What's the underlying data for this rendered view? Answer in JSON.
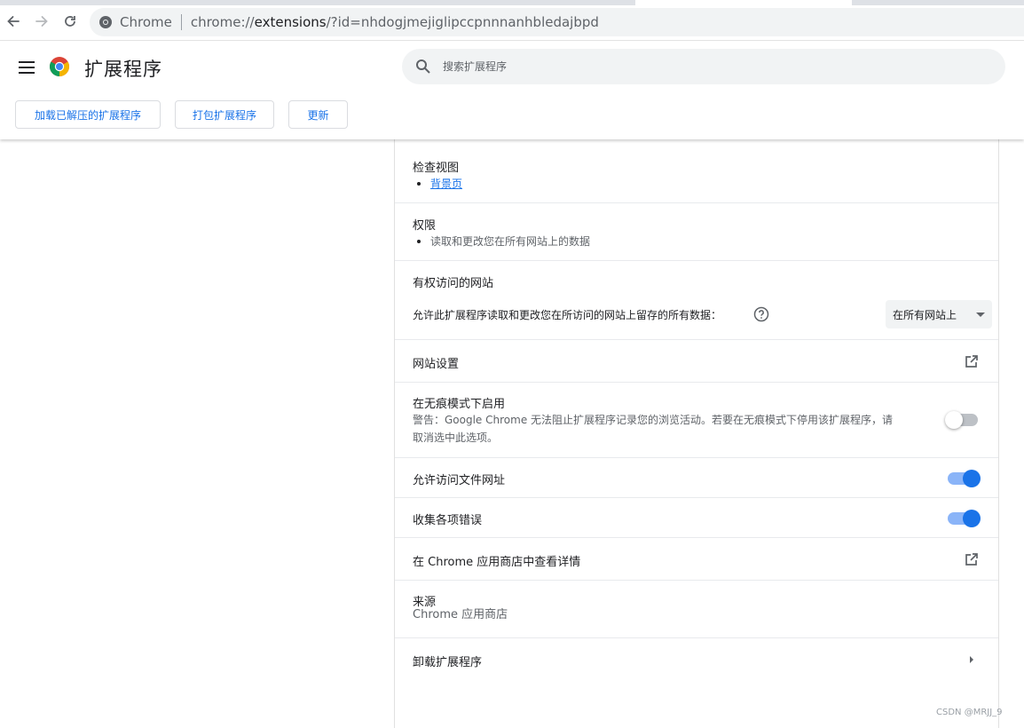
{
  "browser": {
    "site_label": "Chrome",
    "url_scheme": "chrome://",
    "url_host": "extensions",
    "url_path": "/?id=nhdogjmejiglipccpnnnanhbledajbpd"
  },
  "header": {
    "title": "扩展程序",
    "search_placeholder": "搜索扩展程序",
    "buttons": {
      "load_unpacked": "加载已解压的扩展程序",
      "pack": "打包扩展程序",
      "update": "更新"
    }
  },
  "details": {
    "inspect_views": {
      "title": "检查视图",
      "link": "背景页"
    },
    "permissions": {
      "title": "权限",
      "item": "读取和更改您在所有网站上的数据"
    },
    "site_access": {
      "title": "有权访问的网站",
      "description": "允许此扩展程序读取和更改您在所访问的网站上留存的所有数据：",
      "selected_option": "在所有网站上"
    },
    "site_settings": {
      "title": "网站设置"
    },
    "incognito": {
      "title": "在无痕模式下启用",
      "warning_line1": "警告：Google Chrome 无法阻止扩展程序记录您的浏览活动。若要在无痕模式下停用该扩展程序，请",
      "warning_line2": "取消选中此选项。",
      "enabled": false
    },
    "file_urls": {
      "title": "允许访问文件网址",
      "enabled": true
    },
    "collect_errors": {
      "title": "收集各项错误",
      "enabled": true
    },
    "webstore": {
      "title": "在 Chrome 应用商店中查看详情"
    },
    "source": {
      "title": "来源",
      "value": "Chrome 应用商店"
    },
    "remove": {
      "title": "卸载扩展程序"
    }
  },
  "watermark": "CSDN @MRJJ_9",
  "colors": {
    "accent": "#1a73e8",
    "toggle_track_on": "#8ab4f8",
    "surface": "#f1f3f4"
  }
}
